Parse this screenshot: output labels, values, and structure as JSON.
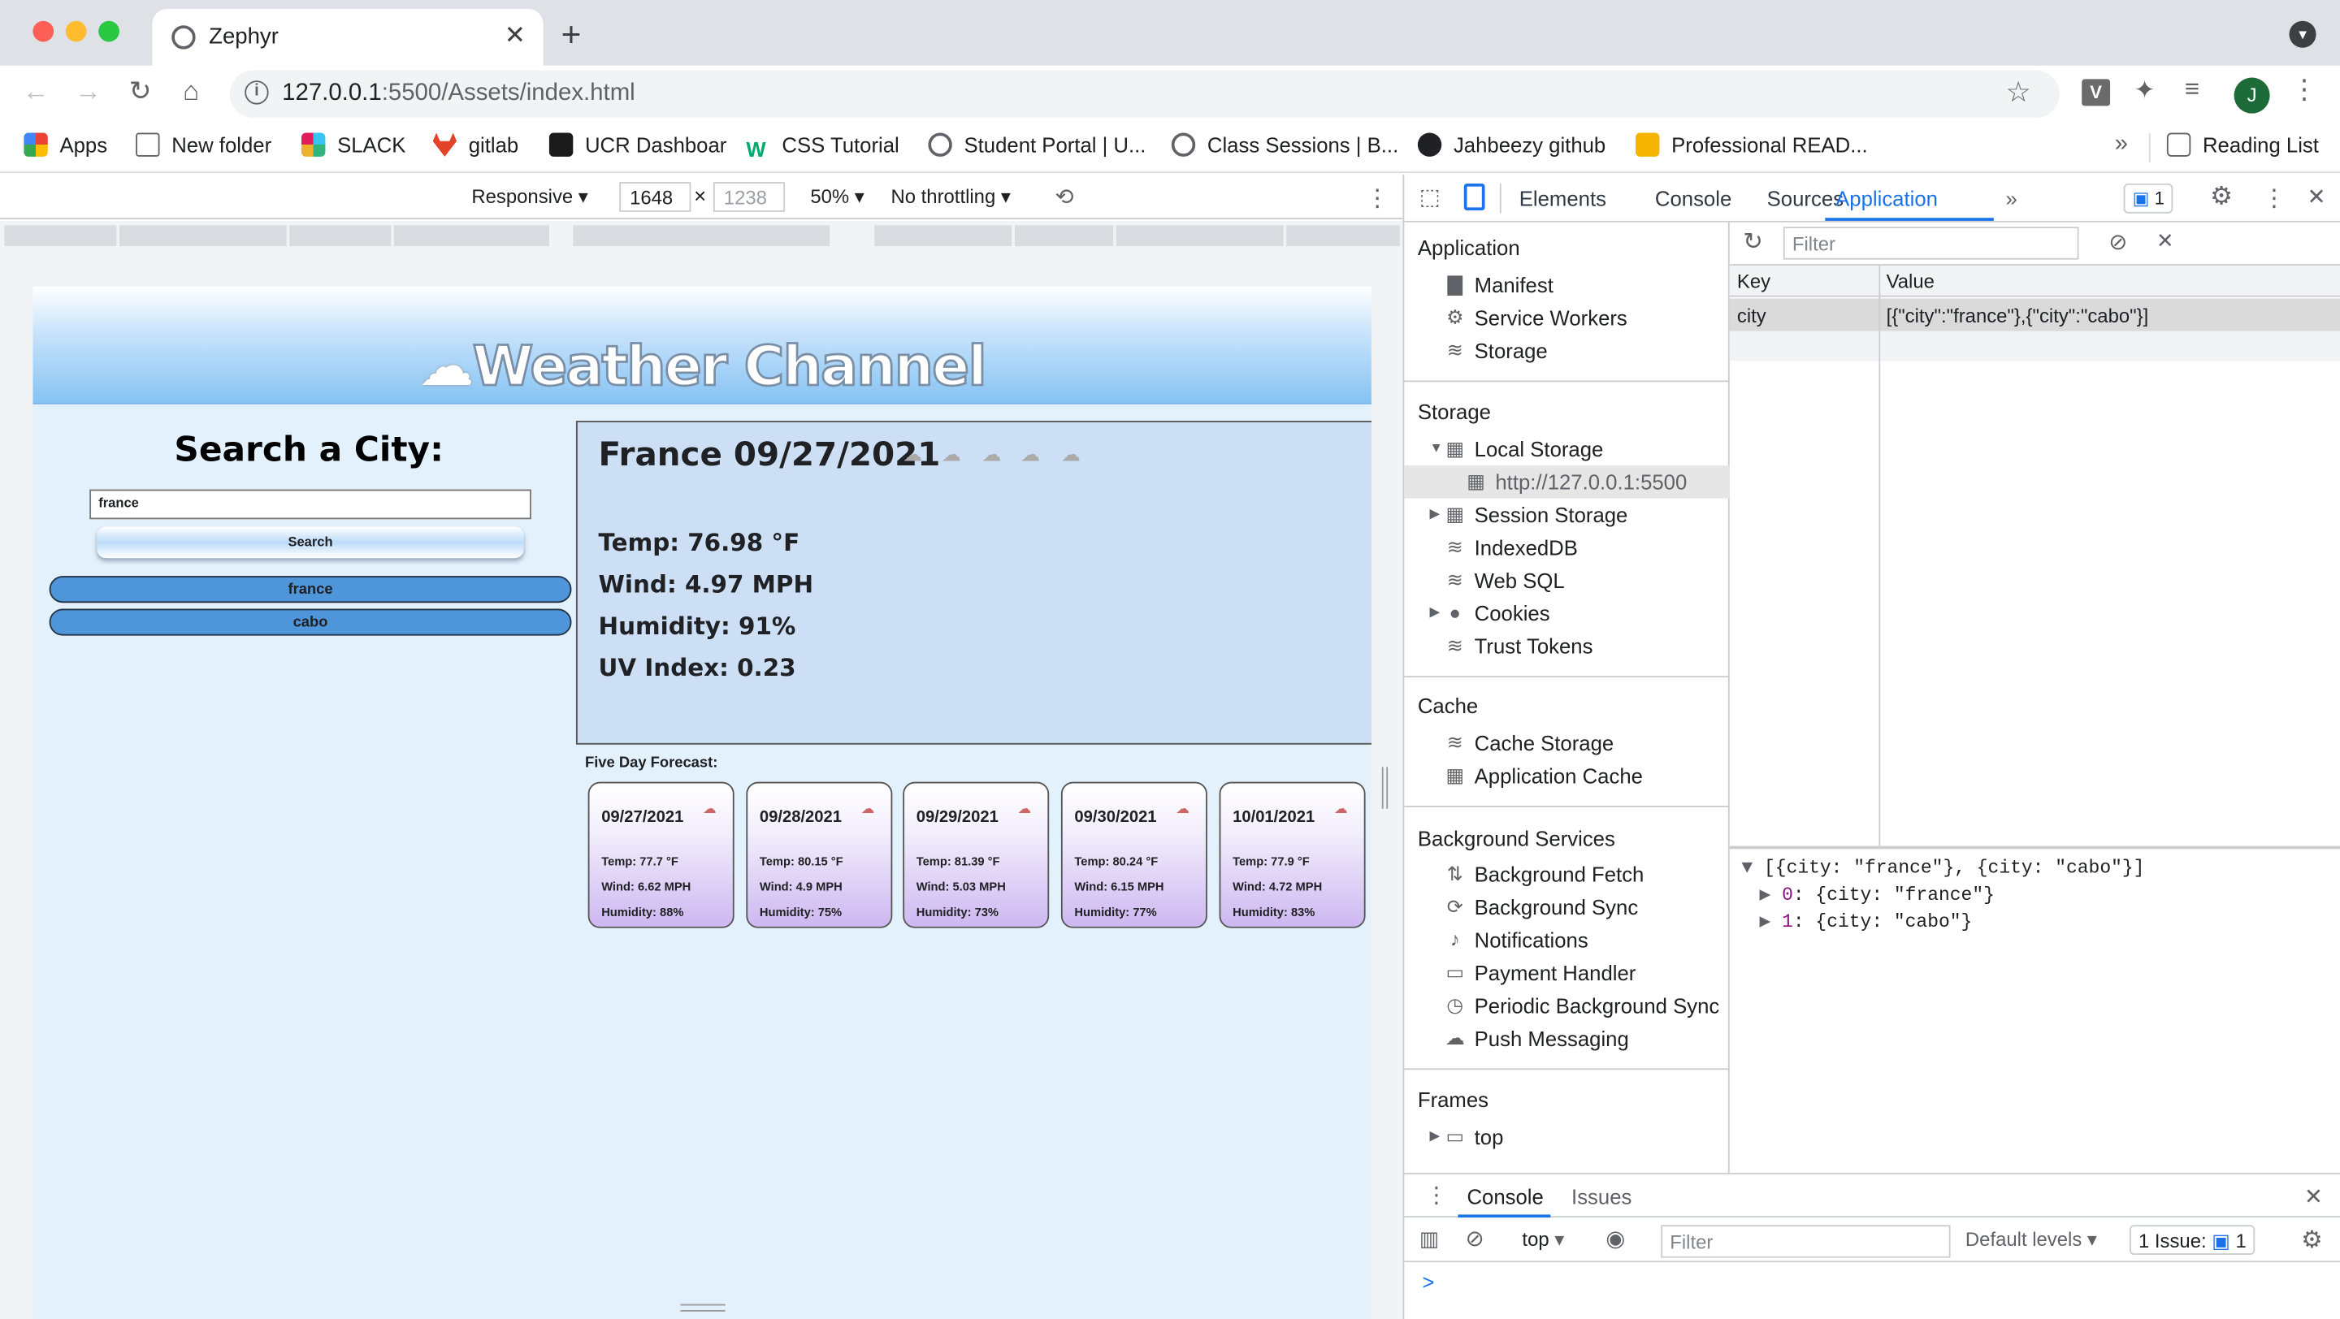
{
  "browser": {
    "tab_title": "Zephyr",
    "url_host": "127.0.0.1",
    "url_path": ":5500/Assets/index.html",
    "profile_initial": "J",
    "extension_label": "V",
    "bookmarks": [
      {
        "label": "Apps",
        "icon": "apps-grid-icon",
        "color": "#4285f4"
      },
      {
        "label": "New folder",
        "icon": "folder-icon",
        "color": "#5f6368"
      },
      {
        "label": "SLACK",
        "icon": "slack-icon",
        "color": "#e01e5a"
      },
      {
        "label": "gitlab",
        "icon": "gitlab-icon",
        "color": "#e24329"
      },
      {
        "label": "UCR Dashboar",
        "icon": "ucr-icon",
        "color": "#1a1a1a"
      },
      {
        "label": "CSS Tutorial",
        "icon": "w3schools-icon",
        "color": "#04aa6d"
      },
      {
        "label": "Student Portal | U...",
        "icon": "globe-icon",
        "color": "#5f6368"
      },
      {
        "label": "Class Sessions | B...",
        "icon": "globe-icon",
        "color": "#5f6368"
      },
      {
        "label": "Jahbeezy github",
        "icon": "github-icon",
        "color": "#202124"
      },
      {
        "label": "Professional READ...",
        "icon": "fs-icon",
        "color": "#f4b400"
      }
    ],
    "reading_list": "Reading List"
  },
  "device_toolbar": {
    "mode": "Responsive",
    "width": "1648",
    "height": "1238",
    "zoom": "50%",
    "throttle": "No throttling"
  },
  "app": {
    "title": "Weather Channel",
    "search_heading": "Search a City:",
    "search_value": "france",
    "search_button": "Search",
    "history": [
      "france",
      "cabo"
    ],
    "current": {
      "title": "France 09/27/2021",
      "temp": "Temp: 76.98 °F",
      "wind": "Wind: 4.97 MPH",
      "humidity": "Humidity: 91%",
      "uv": "UV Index: 0.23"
    },
    "forecast_heading": "Five Day Forecast:",
    "forecast": [
      {
        "date": "09/27/2021",
        "temp": "Temp: 77.7 °F",
        "wind": "Wind: 6.62 MPH",
        "humidity": "Humidity: 88%"
      },
      {
        "date": "09/28/2021",
        "temp": "Temp: 80.15 °F",
        "wind": "Wind: 4.9 MPH",
        "humidity": "Humidity: 75%"
      },
      {
        "date": "09/29/2021",
        "temp": "Temp: 81.39 °F",
        "wind": "Wind: 5.03 MPH",
        "humidity": "Humidity: 73%"
      },
      {
        "date": "09/30/2021",
        "temp": "Temp: 80.24 °F",
        "wind": "Wind: 6.15 MPH",
        "humidity": "Humidity: 77%"
      },
      {
        "date": "10/01/2021",
        "temp": "Temp: 77.9 °F",
        "wind": "Wind: 4.72 MPH",
        "humidity": "Humidity: 83%"
      }
    ]
  },
  "devtools": {
    "tabs": [
      "Elements",
      "Console",
      "Sources",
      "Application"
    ],
    "active_tab": "Application",
    "more_tabs": "»",
    "issues_count": "1",
    "filter_placeholder": "Filter",
    "sections": {
      "application": {
        "title": "Application",
        "items": [
          "Manifest",
          "Service Workers",
          "Storage"
        ]
      },
      "storage": {
        "title": "Storage",
        "items": [
          "Local Storage",
          "http://127.0.0.1:5500",
          "Session Storage",
          "IndexedDB",
          "Web SQL",
          "Cookies",
          "Trust Tokens"
        ]
      },
      "cache": {
        "title": "Cache",
        "items": [
          "Cache Storage",
          "Application Cache"
        ]
      },
      "background": {
        "title": "Background Services",
        "items": [
          "Background Fetch",
          "Background Sync",
          "Notifications",
          "Payment Handler",
          "Periodic Background Sync",
          "Push Messaging"
        ]
      },
      "frames": {
        "title": "Frames",
        "items": [
          "top"
        ]
      }
    },
    "table": {
      "headers": [
        "Key",
        "Value"
      ],
      "rows": [
        {
          "key": "city",
          "value": "[{\"city\":\"france\"},{\"city\":\"cabo\"}]"
        }
      ]
    },
    "preview": {
      "summary": "[{city: \"france\"}, {city: \"cabo\"}]",
      "line0_key": "0",
      "line0_val": ": {city: \"france\"}",
      "line1_key": "1",
      "line1_val": ": {city: \"cabo\"}"
    },
    "drawer": {
      "tabs": [
        "Console",
        "Issues"
      ],
      "context": "top",
      "levels": "Default levels",
      "issues": "1 Issue:",
      "issues_count": "1",
      "prompt": ">"
    }
  }
}
